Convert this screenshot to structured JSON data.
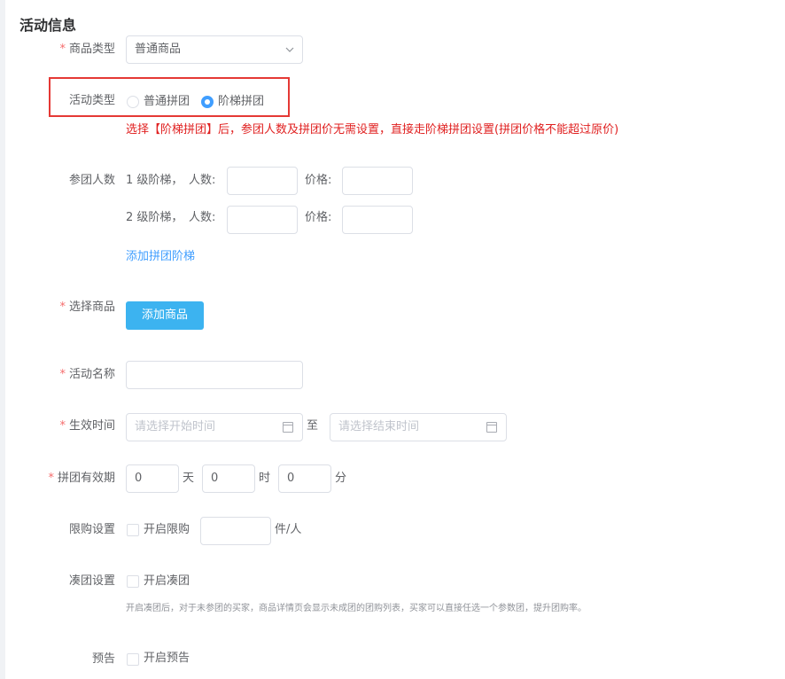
{
  "section": {
    "title": "活动信息"
  },
  "product_type": {
    "label": "商品类型",
    "value": "普通商品"
  },
  "activity_type": {
    "label": "活动类型",
    "options": [
      {
        "label": "普通拼团",
        "checked": false
      },
      {
        "label": "阶梯拼团",
        "checked": true
      }
    ],
    "warning": "选择【阶梯拼团】后，参团人数及拼团价无需设置，直接走阶梯拼团设置(拼团价格不能超过原价)"
  },
  "participants": {
    "label": "参团人数",
    "tiers": [
      {
        "tier_label": "1 级阶梯，",
        "count_label": "人数:",
        "price_label": "价格:"
      },
      {
        "tier_label": "2 级阶梯，",
        "count_label": "人数:",
        "price_label": "价格:"
      }
    ],
    "add_tier_link": "添加拼团阶梯"
  },
  "select_product": {
    "label": "选择商品",
    "button": "添加商品"
  },
  "activity_name": {
    "label": "活动名称",
    "value": ""
  },
  "effective_time": {
    "label": "生效时间",
    "start_placeholder": "请选择开始时间",
    "separator": "至",
    "end_placeholder": "请选择结束时间"
  },
  "validity": {
    "label": "拼团有效期",
    "days": "0",
    "days_unit": "天",
    "hours": "0",
    "hours_unit": "时",
    "minutes": "0",
    "minutes_unit": "分"
  },
  "purchase_limit": {
    "label": "限购设置",
    "checkbox_label": "开启限购",
    "unit": "件/人"
  },
  "group_fill": {
    "label": "凑团设置",
    "checkbox_label": "开启凑团",
    "hint": "开启凑团后，对于未参团的买家，商品详情页会显示未成团的团购列表，买家可以直接任选一个参数团，提升团购率。"
  },
  "preview": {
    "label": "预告",
    "checkbox_label": "开启预告"
  },
  "colors": {
    "accent": "#409eff",
    "required": "#f56c6c",
    "warning": "#e02020",
    "button": "#3cb3f0"
  }
}
